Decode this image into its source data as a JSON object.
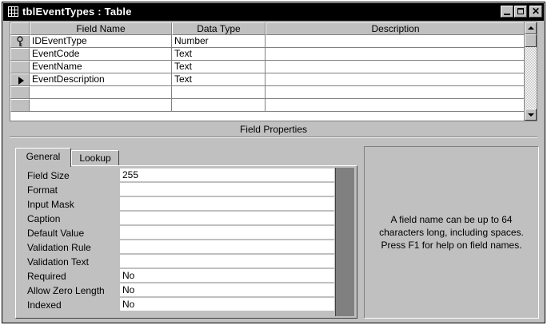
{
  "window": {
    "title": "tblEventTypes : Table",
    "title_icon": "datasheet-table-icon"
  },
  "grid": {
    "columns": [
      "Field Name",
      "Data Type",
      "Description"
    ],
    "rows": [
      {
        "field": "IDEventType",
        "type": "Number",
        "description": "",
        "selector": "primary-key-icon"
      },
      {
        "field": "EventCode",
        "type": "Text",
        "description": "",
        "selector": ""
      },
      {
        "field": "EventName",
        "type": "Text",
        "description": "",
        "selector": ""
      },
      {
        "field": "EventDescription",
        "type": "Text",
        "description": "",
        "selector": "current-row-arrow-icon"
      },
      {
        "field": "",
        "type": "",
        "description": "",
        "selector": ""
      },
      {
        "field": "",
        "type": "",
        "description": "",
        "selector": ""
      }
    ]
  },
  "field_properties": {
    "label": "Field Properties",
    "tabs": [
      "General",
      "Lookup"
    ],
    "active_tab": "General",
    "props": [
      {
        "name": "Field Size",
        "value": "255"
      },
      {
        "name": "Format",
        "value": ""
      },
      {
        "name": "Input Mask",
        "value": ""
      },
      {
        "name": "Caption",
        "value": ""
      },
      {
        "name": "Default Value",
        "value": ""
      },
      {
        "name": "Validation Rule",
        "value": ""
      },
      {
        "name": "Validation Text",
        "value": ""
      },
      {
        "name": "Required",
        "value": "No"
      },
      {
        "name": "Allow Zero Length",
        "value": "No"
      },
      {
        "name": "Indexed",
        "value": "No"
      }
    ],
    "help_text": "A field name can be up to 64 characters long, including spaces. Press F1 for help on field names."
  }
}
